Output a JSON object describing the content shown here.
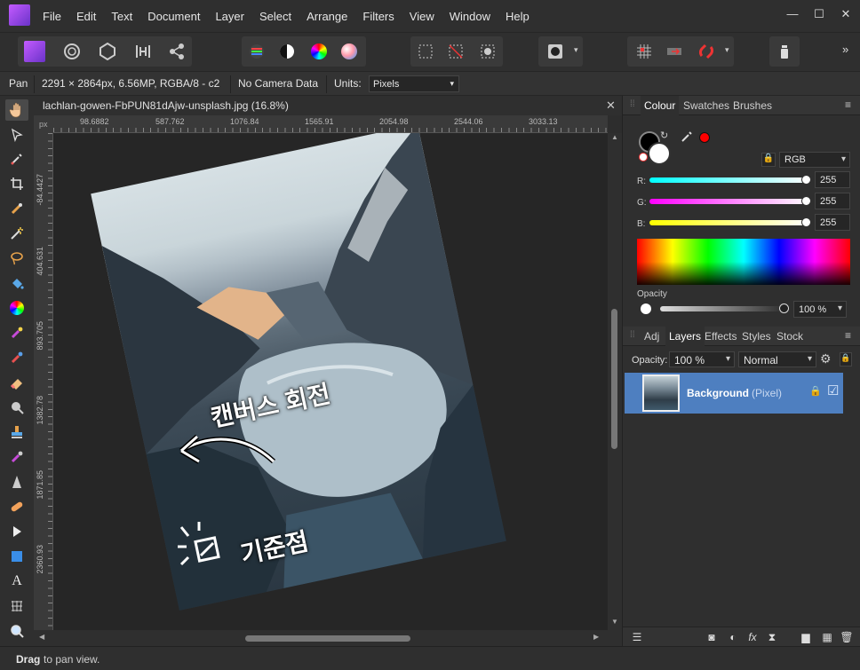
{
  "menu": [
    "File",
    "Edit",
    "Text",
    "Document",
    "Layer",
    "Select",
    "Arrange",
    "Filters",
    "View",
    "Window",
    "Help"
  ],
  "window_controls": {
    "minimize": "—",
    "maximize": "☐",
    "close": "✕"
  },
  "toolbar": {
    "overflow": "»"
  },
  "context": {
    "tool_name": "Pan",
    "image_info": "2291 × 2864px, 6.56MP, RGBA/8 - c2",
    "camera": "No Camera Data",
    "units_label": "Units:",
    "units_value": "Pixels"
  },
  "document": {
    "title": "lachlan-gowen-FbPUN81dAjw-unsplash.jpg (16.8%)",
    "close": "✕",
    "ruler_unit": "px",
    "ruler_top": [
      "98.6882",
      "587.762",
      "1076.84",
      "1565.91",
      "2054.98",
      "2544.06",
      "3033.13"
    ],
    "ruler_left": [
      "-84.4427",
      "404.631",
      "893.705",
      "1382.78",
      "1871.85",
      "2360.93"
    ],
    "annotation_1": "캔버스 회전",
    "annotation_2": "기준점"
  },
  "colour_panel": {
    "tabs": [
      "Colour",
      "Swatches",
      "Brushes"
    ],
    "mode": "RGB",
    "channels": [
      {
        "label": "R:",
        "value": "255",
        "colors": [
          "#00ffff",
          "#ffffff"
        ]
      },
      {
        "label": "G:",
        "value": "255",
        "colors": [
          "#ff00ff",
          "#ffffff"
        ]
      },
      {
        "label": "B:",
        "value": "255",
        "colors": [
          "#ffff00",
          "#ffffff"
        ]
      }
    ],
    "opacity_label": "Opacity",
    "opacity_value": "100 %",
    "picker_color": "#ff0000"
  },
  "layers_panel": {
    "tabs": [
      "Adj",
      "Layers",
      "Effects",
      "Styles",
      "Stock"
    ],
    "opacity_label": "Opacity:",
    "opacity_value": "100 %",
    "blend_mode": "Normal",
    "layer_name": "Background",
    "layer_type": "(Pixel)",
    "checkbox": "☑"
  },
  "status": {
    "bold": "Drag",
    "rest": "to pan view."
  }
}
